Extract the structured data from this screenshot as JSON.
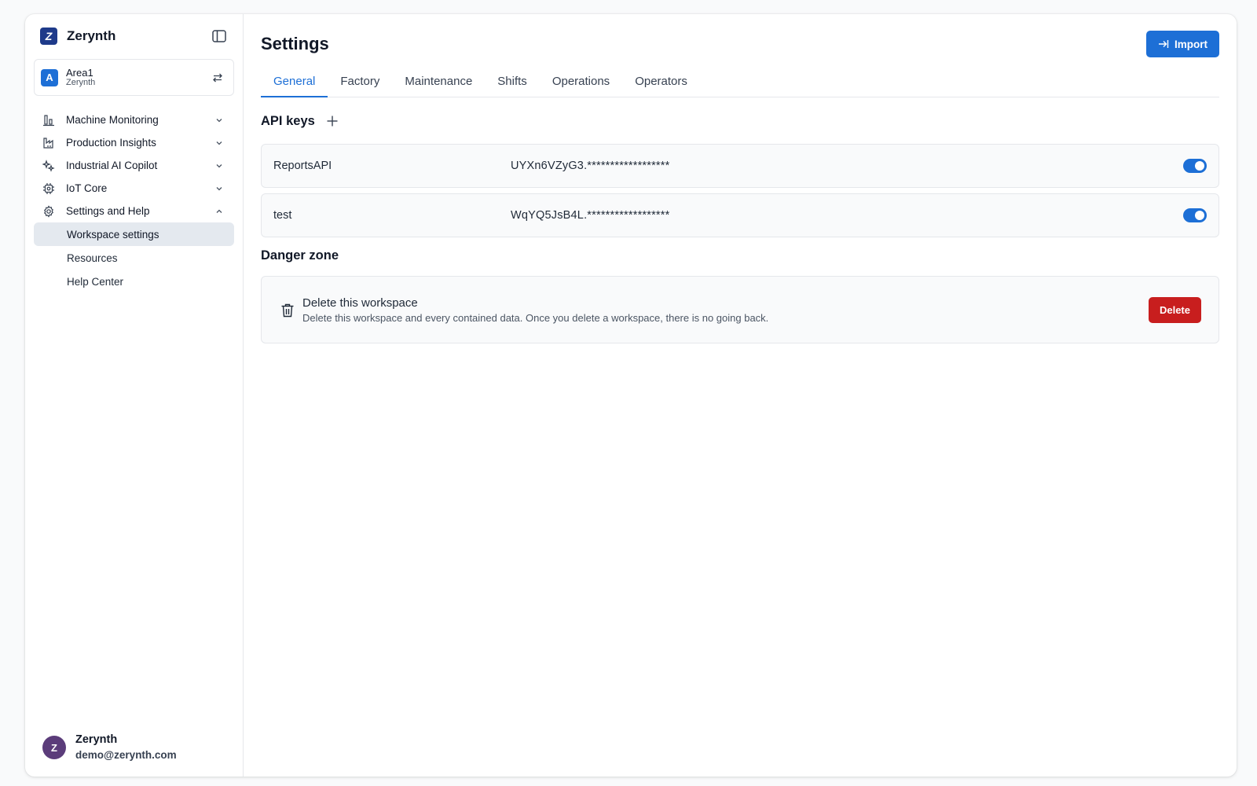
{
  "brand": {
    "logo_letter": "Z",
    "name": "Zerynth"
  },
  "workspace": {
    "avatar_letter": "A",
    "name": "Area1",
    "org": "Zerynth"
  },
  "nav": {
    "items": [
      {
        "label": "Machine Monitoring",
        "icon": "chart-bars-icon",
        "expanded": false
      },
      {
        "label": "Production Insights",
        "icon": "factory-icon",
        "expanded": false
      },
      {
        "label": "Industrial AI Copilot",
        "icon": "sparkles-icon",
        "expanded": false
      },
      {
        "label": "IoT Core",
        "icon": "chip-icon",
        "expanded": false
      },
      {
        "label": "Settings and Help",
        "icon": "gear-icon",
        "expanded": true
      }
    ],
    "sub_items": [
      {
        "label": "Workspace settings",
        "active": true
      },
      {
        "label": "Resources",
        "active": false
      },
      {
        "label": "Help Center",
        "active": false
      }
    ]
  },
  "user": {
    "avatar_letter": "Z",
    "name": "Zerynth",
    "email": "demo@zerynth.com"
  },
  "header": {
    "title": "Settings",
    "import_label": "Import"
  },
  "tabs": [
    {
      "label": "General",
      "active": true
    },
    {
      "label": "Factory",
      "active": false
    },
    {
      "label": "Maintenance",
      "active": false
    },
    {
      "label": "Shifts",
      "active": false
    },
    {
      "label": "Operations",
      "active": false
    },
    {
      "label": "Operators",
      "active": false
    }
  ],
  "api_keys": {
    "title": "API keys",
    "keys": [
      {
        "name": "ReportsAPI",
        "value": "UYXn6VZyG3.******************",
        "enabled": true
      },
      {
        "name": "test",
        "value": "WqYQ5JsB4L.******************",
        "enabled": true
      }
    ]
  },
  "danger_zone": {
    "title": "Danger zone",
    "heading": "Delete this workspace",
    "description": "Delete this workspace and every contained data. Once you delete a workspace, there is no going back.",
    "delete_label": "Delete"
  },
  "colors": {
    "accent": "#1d6fd6",
    "danger": "#c81e1e",
    "brand": "#1e3a8a",
    "user_avatar": "#5b3c7a"
  }
}
